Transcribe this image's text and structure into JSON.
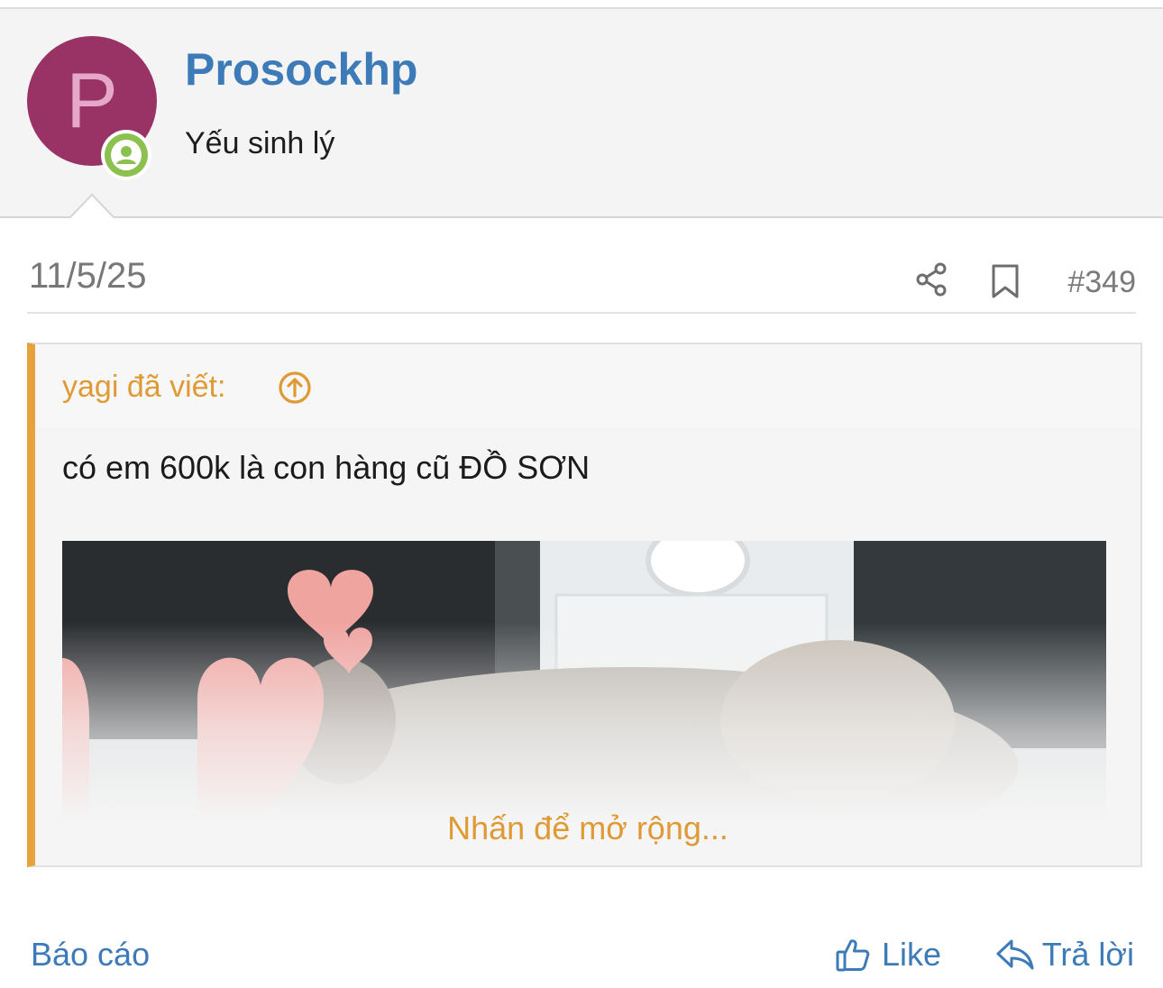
{
  "user": {
    "avatar_letter": "P",
    "username": "Prosockhp",
    "title": "Yếu sinh lý",
    "avatar_color": "#993366",
    "online_badge_color": "#8cc04f"
  },
  "post": {
    "date": "11/5/25",
    "number": "#349",
    "icons": [
      "share-icon",
      "bookmark-icon"
    ]
  },
  "quote": {
    "author_label": "yagi đã viết:",
    "text": "có em 600k là con hàng cũ ĐỒ SƠN",
    "expand_label": "Nhấn để mở rộng...",
    "accent_color": "#e6a33c"
  },
  "actions": {
    "report_label": "Báo cáo",
    "like_label": "Like",
    "reply_label": "Trả lời",
    "link_color": "#3d7ab8"
  }
}
